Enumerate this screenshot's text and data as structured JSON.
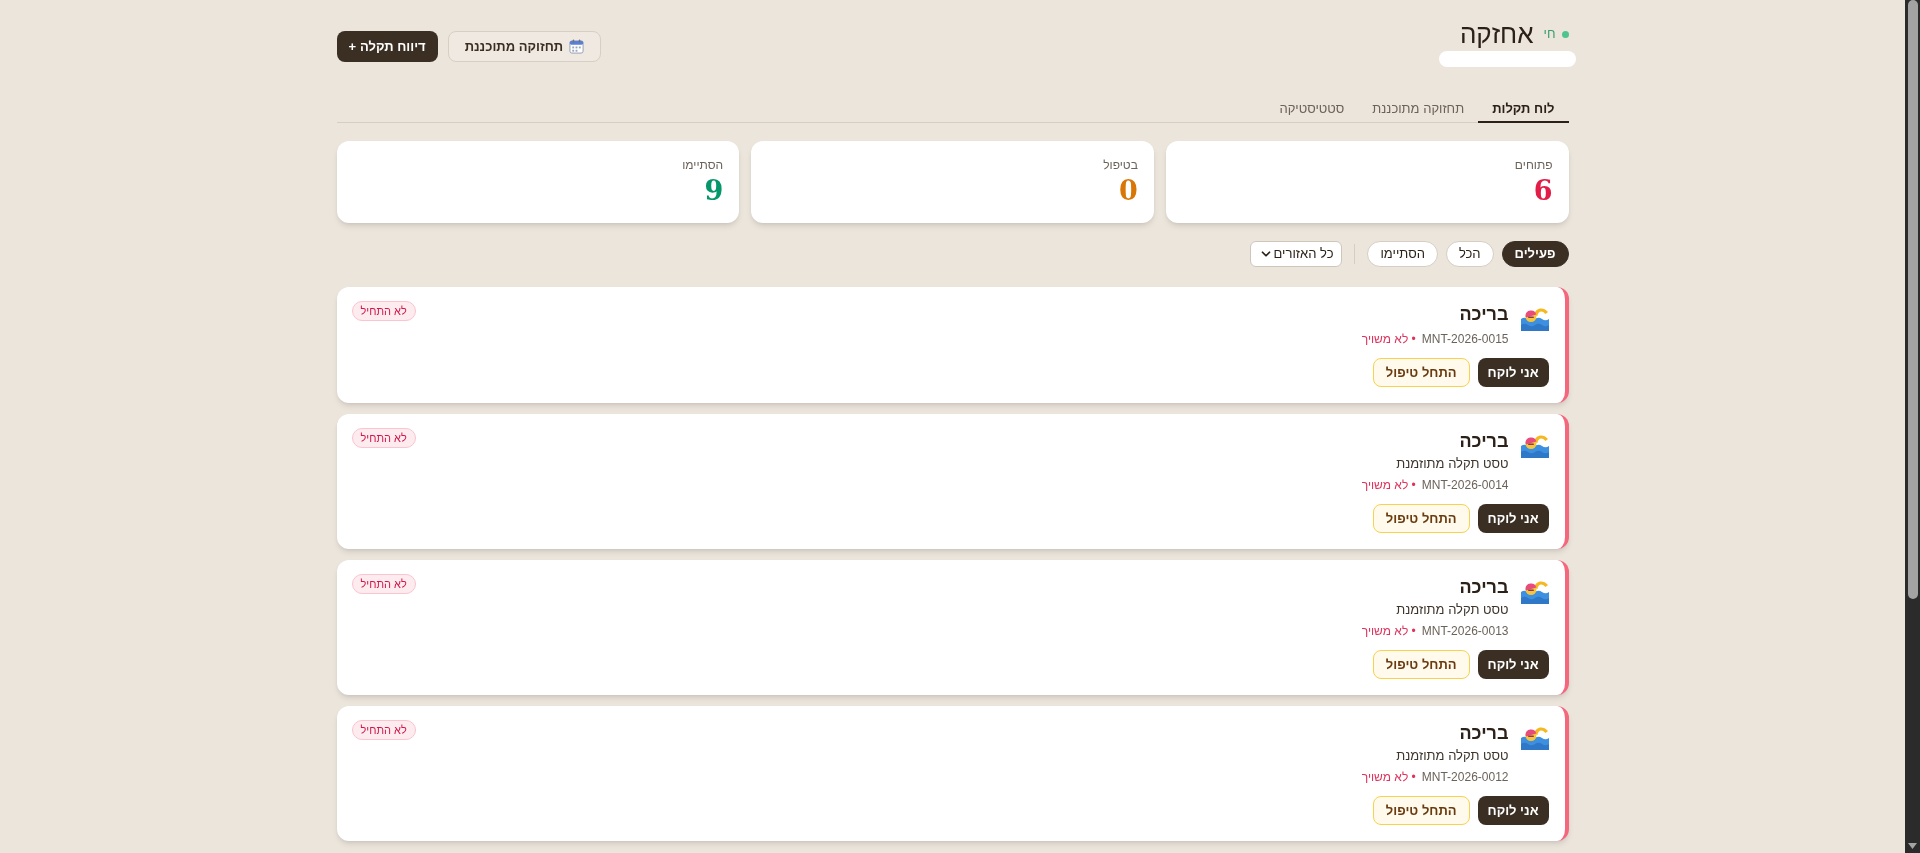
{
  "header": {
    "title": "אחזקה",
    "status": {
      "label": "חי",
      "live": true
    },
    "buttons": [
      {
        "kind": "planned",
        "label": "תחזוקה מתוכננת"
      },
      {
        "kind": "report",
        "label": "דיווח תקלה",
        "symbol": "+"
      }
    ]
  },
  "tabs": [
    {
      "label": "לוח תקלות",
      "selected": true
    },
    {
      "label": "תחזוקה מתוכננת",
      "selected": false
    },
    {
      "label": "סטטיסטיקה",
      "selected": false
    }
  ],
  "stats": [
    {
      "label": "פתוחים",
      "value": "6",
      "color": "#e11d48"
    },
    {
      "label": "בטיפול",
      "value": "0",
      "color": "#d97706"
    },
    {
      "label": "הסתיימו",
      "value": "9",
      "color": "#059669"
    }
  ],
  "filters": {
    "chips": [
      {
        "label": "פעילים",
        "selected": true
      },
      {
        "label": "הכל",
        "selected": false
      },
      {
        "label": "הסתיימו",
        "selected": false
      }
    ],
    "region_select": {
      "value": "כל האזורים"
    }
  },
  "tickets": [
    {
      "title": "בריכה",
      "code": "MNT-2026-0015",
      "assignee": "• לא משויך",
      "status": "לא התחיל",
      "actions": [
        {
          "kind": "primary",
          "label": "אני לוקח"
        },
        {
          "kind": "secondary",
          "label": "התחל טיפול"
        }
      ]
    },
    {
      "title": "בריכה",
      "description": "טסט תקלה מתוזמנת",
      "code": "MNT-2026-0014",
      "assignee": "• לא משויך",
      "status": "לא התחיל",
      "actions": [
        {
          "kind": "primary",
          "label": "אני לוקח"
        },
        {
          "kind": "secondary",
          "label": "התחל טיפול"
        }
      ]
    },
    {
      "title": "בריכה",
      "description": "טסט תקלה מתוזמנת",
      "code": "MNT-2026-0013",
      "assignee": "• לא משויך",
      "status": "לא התחיל",
      "actions": [
        {
          "kind": "primary",
          "label": "אני לוקח"
        },
        {
          "kind": "secondary",
          "label": "התחל טיפול"
        }
      ]
    },
    {
      "title": "בריכה",
      "description": "טסט תקלה מתוזמנת",
      "code": "MNT-2026-0012",
      "assignee": "• לא משויך",
      "status": "לא התחיל",
      "actions": [
        {
          "kind": "primary",
          "label": "אני לוקח"
        },
        {
          "kind": "secondary",
          "label": "התחל טיפול"
        }
      ]
    }
  ]
}
